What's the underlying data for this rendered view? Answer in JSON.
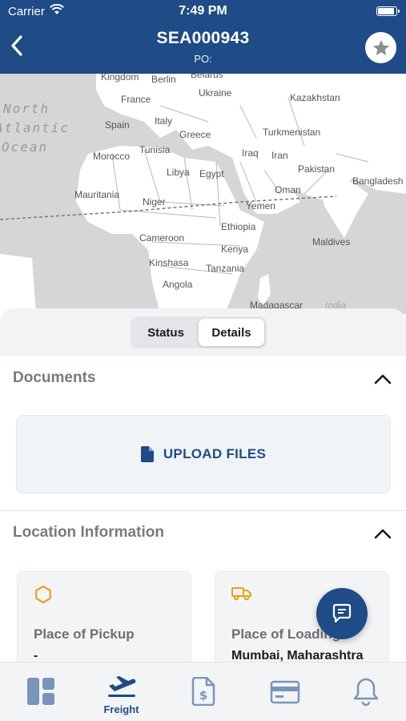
{
  "status_bar": {
    "carrier": "Carrier",
    "time": "7:49 PM"
  },
  "header": {
    "title": "SEA000943",
    "subtitle": "PO:",
    "back_icon": "chevron-left-icon",
    "favorite_icon": "star-icon"
  },
  "map": {
    "labels": [
      "Kingdom",
      "Berlin",
      "Belarus",
      "France",
      "Ukraine",
      "Kazakhstan",
      "Spain",
      "Italy",
      "Greece",
      "Turkmenistan",
      "Morocco",
      "Tunisia",
      "Iraq",
      "Iran",
      "Libya",
      "Egypt",
      "Pakistan",
      "Oman",
      "Bangladesh",
      "Mauritania",
      "Niger",
      "Yemen",
      "Ethiopia",
      "Cameroon",
      "Maldives",
      "Kenya",
      "Kinshasa",
      "Tanzania",
      "Angola",
      "Madagascar"
    ],
    "ocean_lines": [
      "North",
      "Atlantic",
      "Ocean"
    ],
    "indian_ocean": "India"
  },
  "tabs": {
    "status": "Status",
    "details": "Details",
    "active": "details"
  },
  "documents": {
    "title": "Documents",
    "upload_label": "UPLOAD FILES",
    "collapse_icon": "chevron-up-icon"
  },
  "location": {
    "title": "Location Information",
    "collapse_icon": "chevron-up-icon",
    "cards": [
      {
        "label": "Place of Pickup",
        "value": "-",
        "icon": "hexagon-icon"
      },
      {
        "label": "Place of Loading",
        "value": "Mumbai, Maharashtra",
        "icon": "truck-icon"
      }
    ]
  },
  "chat": {
    "icon": "chat-icon"
  },
  "bottom_nav": [
    {
      "key": "dashboard",
      "label": "",
      "icon": "dashboard-icon"
    },
    {
      "key": "freight",
      "label": "Freight",
      "icon": "plane-departure-icon",
      "active": true
    },
    {
      "key": "invoices",
      "label": "",
      "icon": "invoice-icon"
    },
    {
      "key": "payments",
      "label": "",
      "icon": "credit-card-icon"
    },
    {
      "key": "notifications",
      "label": "",
      "icon": "bell-icon"
    }
  ],
  "colors": {
    "primary": "#1f4b86",
    "accent": "#e8a317",
    "map_land": "#ffffff",
    "map_water": "#d6d6d6"
  }
}
